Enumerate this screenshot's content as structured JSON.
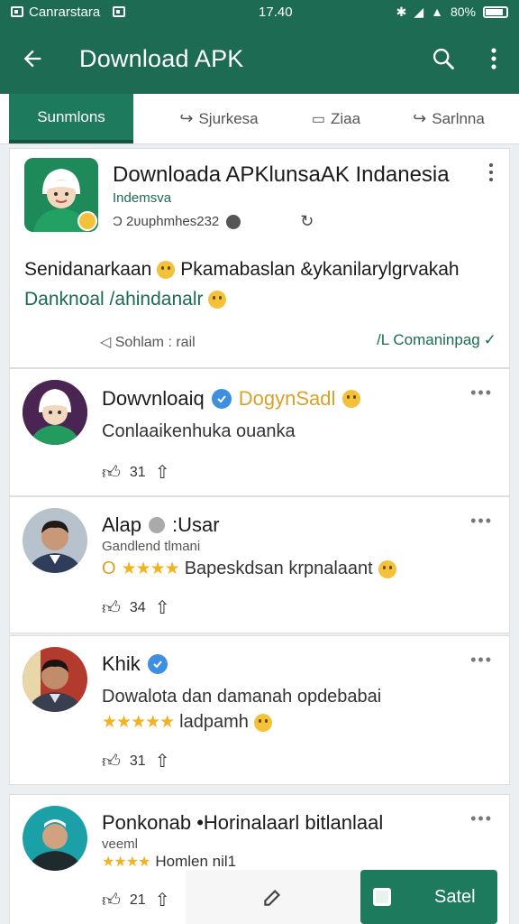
{
  "status": {
    "carrier": "Canrarstara",
    "time": "17.40",
    "battery": "80%",
    "battery_level": 0.8
  },
  "appbar": {
    "title": "Download APK",
    "icons": [
      "back-arrow-icon",
      "search-icon",
      "more-vert-icon"
    ]
  },
  "tabs": [
    {
      "label": "Sunmlons",
      "active": true
    },
    {
      "label": "Sjurkesa",
      "icon": "share-icon"
    },
    {
      "label": "Ziaa",
      "icon": "edit-icon"
    },
    {
      "label": "Sarlnna",
      "icon": "share-icon"
    }
  ],
  "app_card": {
    "title": "Downloada APKlunsaAK Indanesia",
    "subtitle": "Indemsva",
    "meta": "Ɔ 2ʋuphmhes232",
    "desc_line1": "Senidanarkaan",
    "desc_line1b": "Pkamabaslan &ykanilarylgrvakah",
    "desc_line2": "Danknoal /ahindanalr",
    "link_left": "◁ Sohlam : rail",
    "link_right": "/L Comaninpag"
  },
  "posts": [
    {
      "name": "Dowvnloaiq",
      "badge": "DogynSadl",
      "text": "Conlaaikenhuka ouanka",
      "likes": "31"
    },
    {
      "name": "Alap",
      "name_suffix": ":Usar",
      "subline": "Gandlend tlmani",
      "rating_prefix": "O",
      "rating_text": "Bapeskdsan krpnalaant",
      "likes": "34"
    },
    {
      "name": "Khik",
      "text": "Dowalota dan damanah opdebabai",
      "rating_text": "ladpamh",
      "likes": "31"
    },
    {
      "name": "Ponkonab •Horinalaarl bitlanlaal",
      "subline": "veeml",
      "rating_text": "Homlen nil1",
      "likes": "21"
    }
  ],
  "bottom": {
    "button_label": "Satel"
  }
}
